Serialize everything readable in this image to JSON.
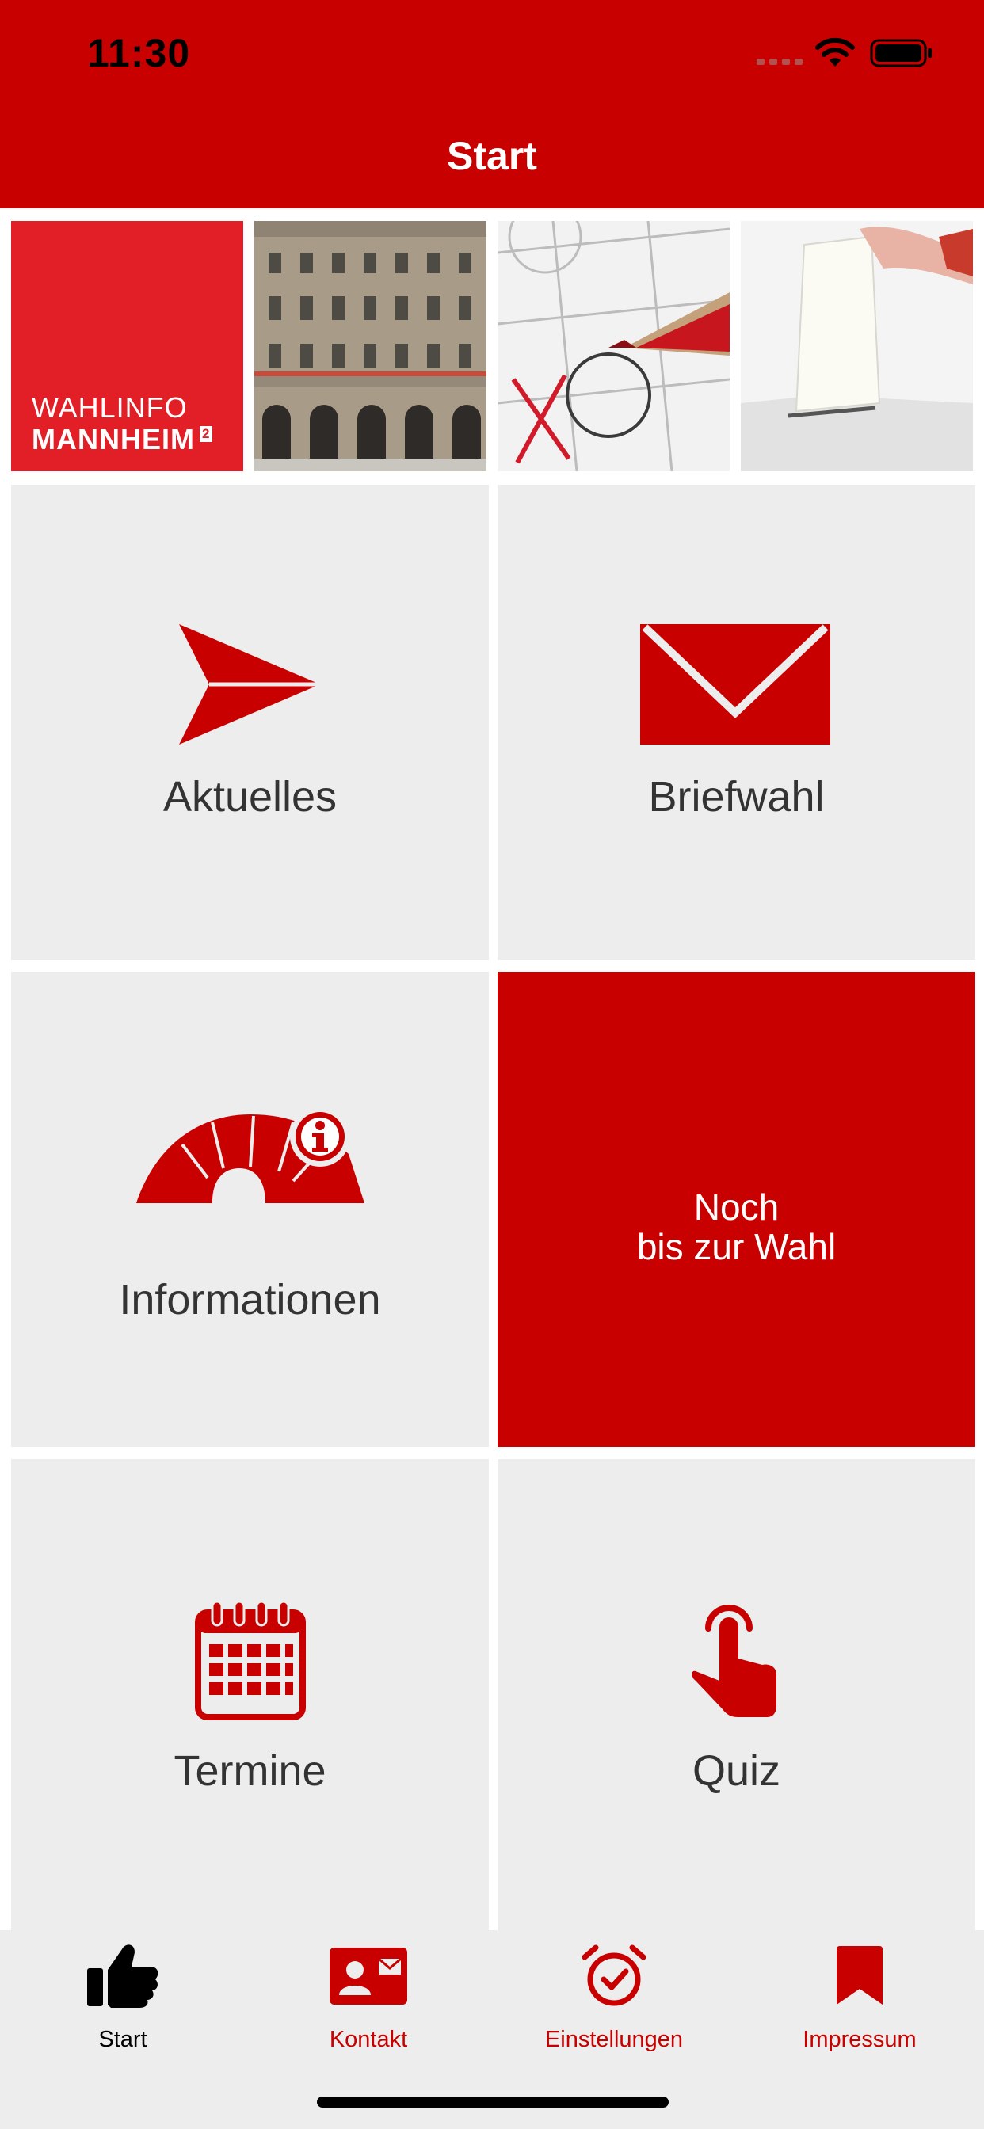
{
  "status_bar": {
    "time": "11:30"
  },
  "nav": {
    "title": "Start"
  },
  "banner": {
    "logo_line1": "WAHLINFO",
    "logo_line2": "MANNHEIM",
    "logo_superscript": "2"
  },
  "tiles": {
    "aktuelles": "Aktuelles",
    "briefwahl": "Briefwahl",
    "informationen": "Informationen",
    "countdown_line1": "Noch",
    "countdown_line2": "bis zur Wahl",
    "termine": "Termine",
    "quiz": "Quiz"
  },
  "tabbar": {
    "start": "Start",
    "kontakt": "Kontakt",
    "einstellungen": "Einstellungen",
    "impressum": "Impressum"
  },
  "colors": {
    "brand_red": "#c80000",
    "logo_red": "#e21f26",
    "tile_bg": "#ededed",
    "text_dark": "#333333"
  },
  "icons": [
    "send-icon",
    "envelope-icon",
    "info-building-icon",
    "calendar-icon",
    "tap-finger-icon",
    "thumbs-up-icon",
    "contact-card-icon",
    "alarm-clock-icon",
    "bookmark-icon"
  ]
}
